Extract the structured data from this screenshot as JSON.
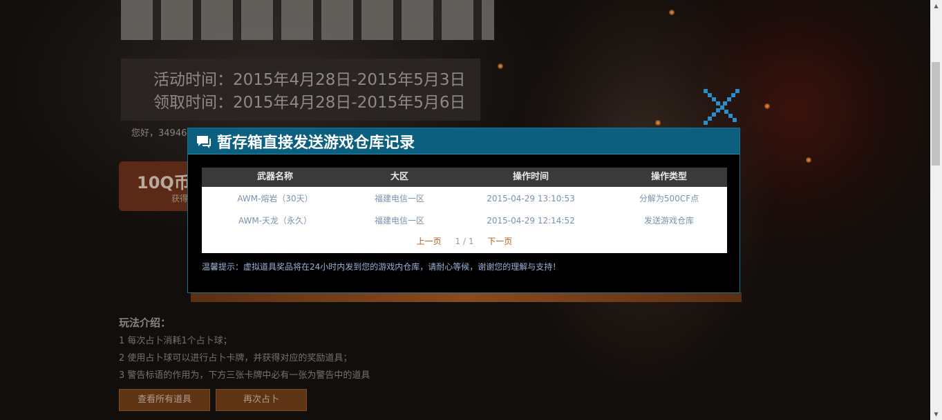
{
  "background": {
    "activity_time": "活动时间：2015年4月28日-2015年5月3日",
    "claim_time": "领取时间：2015年4月28日-2015年5月6日",
    "greeting": "您好，34946",
    "coin_label": "10Q币",
    "coin_sub": "获得",
    "rules_title": "玩法介绍：",
    "rules": [
      "1  每次占卜消耗1个占卜球；",
      "2  使用占卜球可以进行占卜卡牌，并获得对应的奖励道具；",
      "3  警告标语的作用为，下方三张卡牌中必有一张为警告中的道具"
    ],
    "buttons": {
      "view_all": "查看所有道具",
      "divine_again": "再次占卜"
    }
  },
  "modal": {
    "title": "暂存箱直接发送游戏仓库记录",
    "columns": [
      "武器名称",
      "大区",
      "操作时间",
      "操作类型"
    ],
    "rows": [
      [
        "AWM-熔岩（30天）",
        "福建电信一区",
        "2015-04-29 13:10:53",
        "分解为500CF点"
      ],
      [
        "AWM-天龙（永久）",
        "福建电信一区",
        "2015-04-29 12:14:52",
        "发送游戏仓库"
      ]
    ],
    "pager": {
      "prev": "上一页",
      "info": "1 / 1",
      "next": "下一页"
    },
    "tip": "温馨提示：虚拟道具奖品将在24小时内发到您的游戏内仓库，请耐心等候，谢谢您的理解与支持！"
  },
  "colors": {
    "header_bg": "#0d5f7f",
    "close_icon": "#2a8fc8",
    "link_text": "#7a91ad",
    "pager_link": "#b45a18",
    "tip_text": "#9ab2d6"
  },
  "icons": {
    "close": "close-x-icon",
    "header": "chat-bubble-icon"
  }
}
